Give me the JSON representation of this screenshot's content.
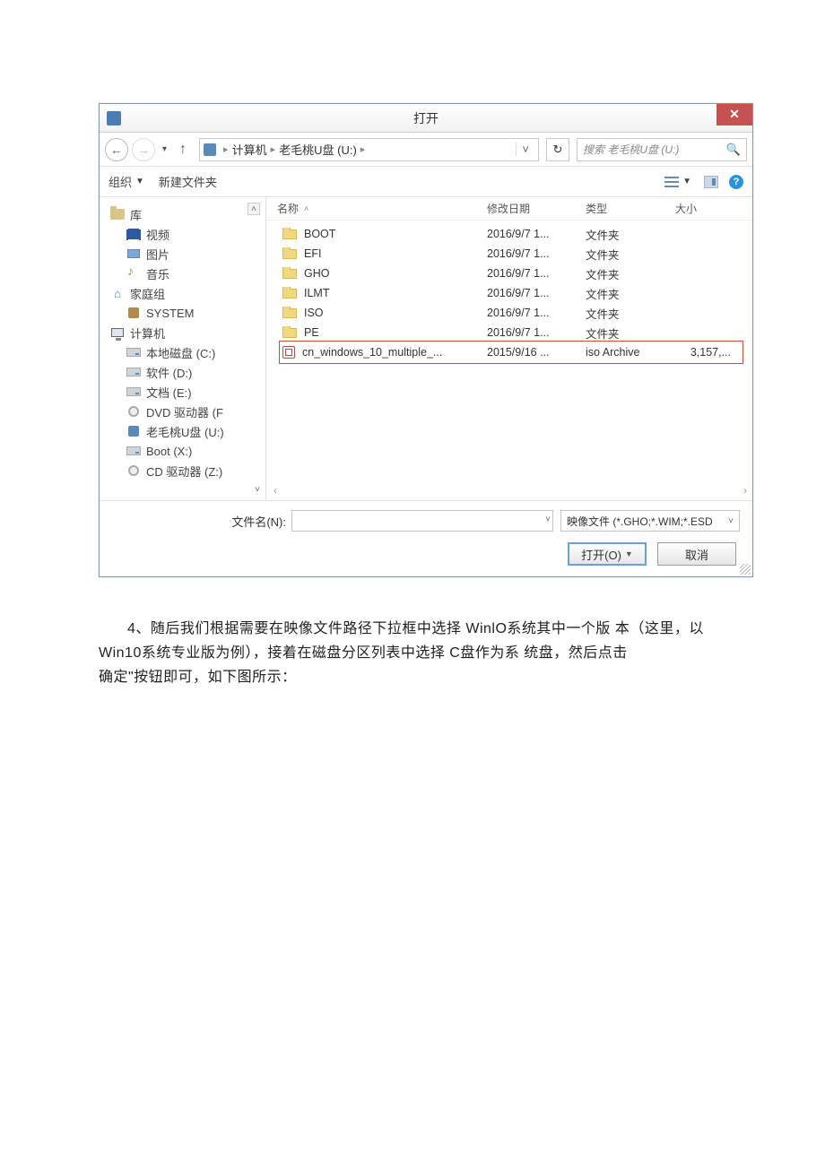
{
  "titlebar": {
    "title": "打开"
  },
  "nav": {
    "breadcrumb": {
      "root": "计算机",
      "current": "老毛桃U盘 (U:)",
      "sep": "▸"
    },
    "search_placeholder": "搜索 老毛桃U盘 (U:)"
  },
  "toolbar": {
    "organize": "组织",
    "newfolder": "新建文件夹"
  },
  "tree": {
    "libraries": "库",
    "videos": "视频",
    "pictures": "图片",
    "music": "音乐",
    "homegroup": "家庭组",
    "system": "SYSTEM",
    "computer": "计算机",
    "local_c": "本地磁盘 (C:)",
    "soft_d": "软件 (D:)",
    "docs_e": "文档 (E:)",
    "dvd_f": "DVD 驱动器 (F",
    "usb_u": "老毛桃U盘 (U:)",
    "boot_x": "Boot (X:)",
    "cd_z": "CD 驱动器 (Z:)"
  },
  "columns": {
    "name": "名称",
    "date": "修改日期",
    "type": "类型",
    "size": "大小"
  },
  "files": [
    {
      "name": "BOOT",
      "date": "2016/9/7 1...",
      "type": "文件夹",
      "size": "",
      "icon": "folder"
    },
    {
      "name": "EFI",
      "date": "2016/9/7 1...",
      "type": "文件夹",
      "size": "",
      "icon": "folder"
    },
    {
      "name": "GHO",
      "date": "2016/9/7 1...",
      "type": "文件夹",
      "size": "",
      "icon": "folder"
    },
    {
      "name": "ILMT",
      "date": "2016/9/7 1...",
      "type": "文件夹",
      "size": "",
      "icon": "folder"
    },
    {
      "name": "ISO",
      "date": "2016/9/7 1...",
      "type": "文件夹",
      "size": "",
      "icon": "folder"
    },
    {
      "name": "PE",
      "date": "2016/9/7 1...",
      "type": "文件夹",
      "size": "",
      "icon": "folder"
    },
    {
      "name": "cn_windows_10_multiple_...",
      "date": "2015/9/16 ...",
      "type": "iso Archive",
      "size": "3,157,...",
      "icon": "disc",
      "selected": true
    }
  ],
  "footer": {
    "filename_label": "文件名(N):",
    "filetype": "映像文件 (*.GHO;*.WIM;*.ESD",
    "open": "打开(O)",
    "cancel": "取消"
  },
  "instruction": {
    "p1": "4、随后我们根据需要在映像文件路径下拉框中选择  WinlO系统其中一个版  本（这里，以Win10系统专业版为例），接着在磁盘分区列表中选择  C盘作为系  统盘，然后点击",
    "p2": "确定\"按钮即可，如下图所示："
  }
}
